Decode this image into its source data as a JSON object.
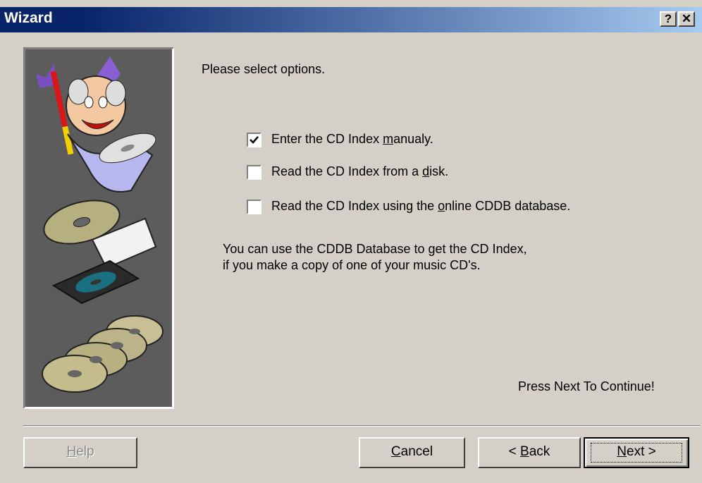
{
  "window": {
    "title": "Wizard",
    "help_glyph": "?",
    "close_glyph": "✕"
  },
  "content": {
    "prompt": "Please select options.",
    "options": [
      {
        "pre": "Enter the CD Index ",
        "ul": "m",
        "post": "anualy.",
        "checked": true
      },
      {
        "pre": "Read the CD Index from a ",
        "ul": "d",
        "post": "isk.",
        "checked": false
      },
      {
        "pre": "Read the CD Index using the ",
        "ul": "o",
        "post": "nline CDDB database.",
        "checked": false
      }
    ],
    "info_line1": "You can use the CDDB Database to get the CD Index,",
    "info_line2": "if you make a copy of one of your music CD's.",
    "continue_hint": "Press Next To Continue!"
  },
  "buttons": {
    "help": {
      "ul": "H",
      "post": "elp",
      "enabled": false
    },
    "cancel": {
      "ul": "C",
      "post": "ancel"
    },
    "back": {
      "pre": "< ",
      "ul": "B",
      "post": "ack"
    },
    "next": {
      "ul": "N",
      "post": "ext >"
    }
  },
  "picture": {
    "icons": [
      "wizard-magician-icon",
      "cd-jewel-case-icon",
      "cd-stack-icon"
    ]
  }
}
